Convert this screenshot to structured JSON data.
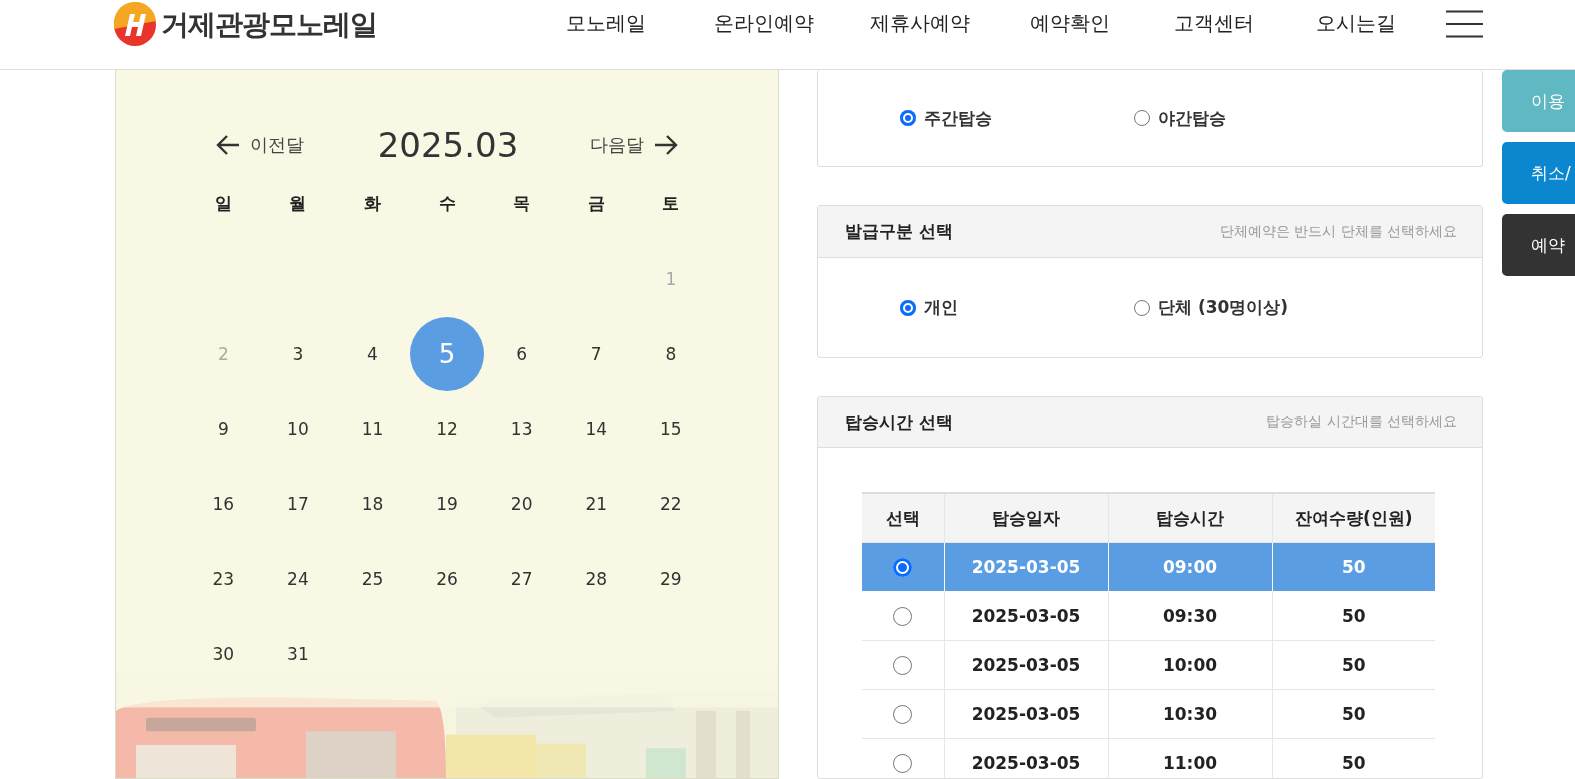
{
  "header": {
    "logo_text": "거제관광모노레일",
    "nav": [
      "모노레일",
      "온라인예약",
      "제휴사예약",
      "예약확인",
      "고객센터",
      "오시는길"
    ]
  },
  "calendar": {
    "prev_label": "이전달",
    "month": "2025.03",
    "next_label": "다음달",
    "weekdays": [
      "일",
      "월",
      "화",
      "수",
      "목",
      "금",
      "토"
    ],
    "weeks": [
      {
        "days": [
          {
            "kind": "blank"
          },
          {
            "kind": "blank"
          },
          {
            "kind": "blank"
          },
          {
            "kind": "blank"
          },
          {
            "kind": "blank"
          },
          {
            "kind": "blank"
          },
          {
            "kind": "day",
            "day": "1",
            "disabled": true,
            "selected": false
          }
        ]
      },
      {
        "days": [
          {
            "day": "2",
            "disabled": true,
            "selected": false
          },
          {
            "day": "3",
            "disabled": false,
            "selected": false
          },
          {
            "day": "4",
            "disabled": false,
            "selected": false
          },
          {
            "day": "5",
            "disabled": false,
            "selected": true
          },
          {
            "day": "6",
            "disabled": false,
            "selected": false
          },
          {
            "day": "7",
            "disabled": false,
            "selected": false
          },
          {
            "day": "8",
            "disabled": false,
            "selected": false
          }
        ]
      },
      {
        "days": [
          {
            "day": "9",
            "disabled": false,
            "selected": false
          },
          {
            "day": "10",
            "disabled": false,
            "selected": false
          },
          {
            "day": "11",
            "disabled": false,
            "selected": false
          },
          {
            "day": "12",
            "disabled": false,
            "selected": false
          },
          {
            "day": "13",
            "disabled": false,
            "selected": false
          },
          {
            "day": "14",
            "disabled": false,
            "selected": false
          },
          {
            "day": "15",
            "disabled": false,
            "selected": false
          }
        ]
      },
      {
        "days": [
          {
            "day": "16",
            "disabled": false,
            "selected": false
          },
          {
            "day": "17",
            "disabled": false,
            "selected": false
          },
          {
            "day": "18",
            "disabled": false,
            "selected": false
          },
          {
            "day": "19",
            "disabled": false,
            "selected": false
          },
          {
            "day": "20",
            "disabled": false,
            "selected": false
          },
          {
            "day": "21",
            "disabled": false,
            "selected": false
          },
          {
            "day": "22",
            "disabled": false,
            "selected": false
          }
        ]
      },
      {
        "days": [
          {
            "day": "23",
            "disabled": false,
            "selected": false
          },
          {
            "day": "24",
            "disabled": false,
            "selected": false
          },
          {
            "day": "25",
            "disabled": false,
            "selected": false
          },
          {
            "day": "26",
            "disabled": false,
            "selected": false
          },
          {
            "day": "27",
            "disabled": false,
            "selected": false
          },
          {
            "day": "28",
            "disabled": false,
            "selected": false
          },
          {
            "day": "29",
            "disabled": false,
            "selected": false
          }
        ]
      },
      {
        "days": [
          {
            "day": "30",
            "disabled": false,
            "selected": false
          },
          {
            "day": "31",
            "disabled": false,
            "selected": false
          },
          {
            "kind": "blank"
          },
          {
            "kind": "blank"
          },
          {
            "kind": "blank"
          },
          {
            "kind": "blank"
          },
          {
            "kind": "blank"
          }
        ]
      }
    ]
  },
  "ride_type": {
    "options": [
      {
        "label": "주간탑승",
        "selected": true
      },
      {
        "label": "야간탑승",
        "selected": false
      }
    ]
  },
  "issue_type": {
    "title": "발급구분 선택",
    "hint": "단체예약은 반드시 단체를 선택하세요",
    "options": [
      {
        "label": "개인",
        "selected": true
      },
      {
        "label": "단체 (30명이상)",
        "selected": false
      }
    ]
  },
  "ride_time": {
    "title": "탑승시간 선택",
    "hint": "탑승하실 시간대를 선택하세요",
    "columns": [
      "선택",
      "탑승일자",
      "탑승시간",
      "잔여수량(인원)"
    ],
    "rows": [
      {
        "date": "2025-03-05",
        "time": "09:00",
        "remaining": "50",
        "selected": true
      },
      {
        "date": "2025-03-05",
        "time": "09:30",
        "remaining": "50",
        "selected": false
      },
      {
        "date": "2025-03-05",
        "time": "10:00",
        "remaining": "50",
        "selected": false
      },
      {
        "date": "2025-03-05",
        "time": "10:30",
        "remaining": "50",
        "selected": false
      },
      {
        "date": "2025-03-05",
        "time": "11:00",
        "remaining": "50",
        "selected": false
      }
    ]
  },
  "side_buttons": [
    {
      "label": "이용",
      "kind": "info"
    },
    {
      "label": "취소/",
      "kind": "cancel"
    },
    {
      "label": "예약",
      "kind": "check"
    }
  ]
}
